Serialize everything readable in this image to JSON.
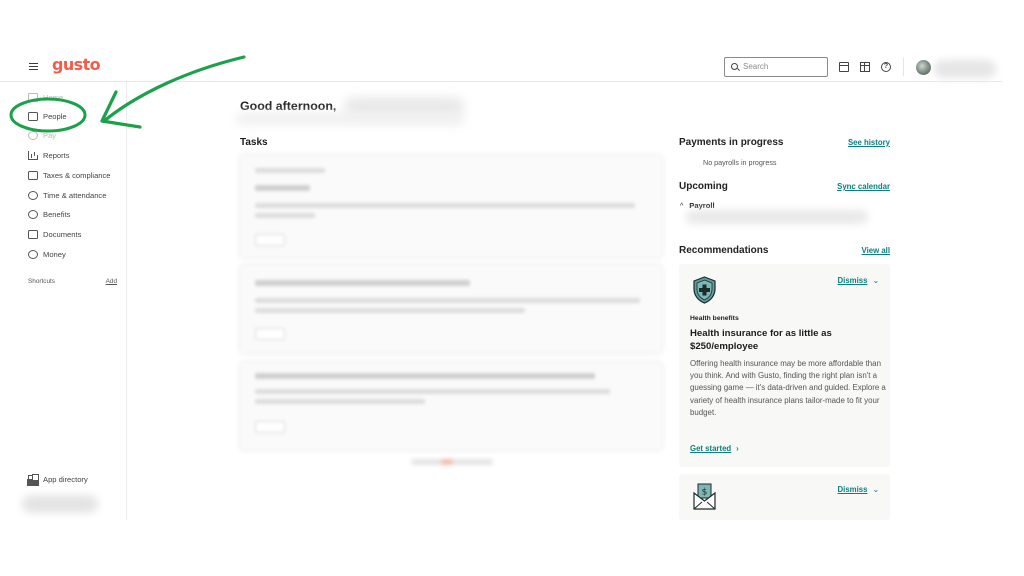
{
  "header": {
    "logo": "gusto",
    "search_placeholder": "Search",
    "icons": [
      "menu-icon",
      "search-icon",
      "calendar-icon",
      "gift-icon",
      "help-icon"
    ]
  },
  "sidebar": {
    "items": [
      {
        "label": "Home",
        "icon": "home-icon"
      },
      {
        "label": "People",
        "icon": "people-icon"
      },
      {
        "label": "Pay",
        "icon": "pay-icon"
      },
      {
        "label": "Reports",
        "icon": "reports-icon"
      },
      {
        "label": "Taxes & compliance",
        "icon": "bank-icon"
      },
      {
        "label": "Time & attendance",
        "icon": "clock-icon"
      },
      {
        "label": "Benefits",
        "icon": "heart-icon"
      },
      {
        "label": "Documents",
        "icon": "document-icon"
      },
      {
        "label": "Money",
        "icon": "dollar-icon"
      }
    ],
    "shortcuts_label": "Shortcuts",
    "shortcuts_add": "Add",
    "app_directory": "App directory"
  },
  "main": {
    "greeting": "Good afternoon,",
    "tasks_title": "Tasks"
  },
  "right": {
    "payments_title": "Payments in progress",
    "payments_link": "See history",
    "no_payrolls": "No payrolls in progress",
    "upcoming_title": "Upcoming",
    "upcoming_link": "Sync calendar",
    "payroll_label": "Payroll",
    "recommendations_title": "Recommendations",
    "recommendations_link": "View all",
    "cards": [
      {
        "dismiss": "Dismiss",
        "kicker": "Health benefits",
        "title": "Health insurance for as little as $250/employee",
        "body": "Offering health insurance may be more affordable than you think. And with Gusto, finding the right plan isn't a guessing game — it's data-driven and guided. Explore a variety of health insurance plans tailor-made to fit your budget.",
        "cta": "Get started"
      },
      {
        "dismiss": "Dismiss"
      }
    ]
  },
  "colors": {
    "brand": "#f45d48",
    "link": "#0a8080",
    "annotation": "#1aa14a"
  }
}
